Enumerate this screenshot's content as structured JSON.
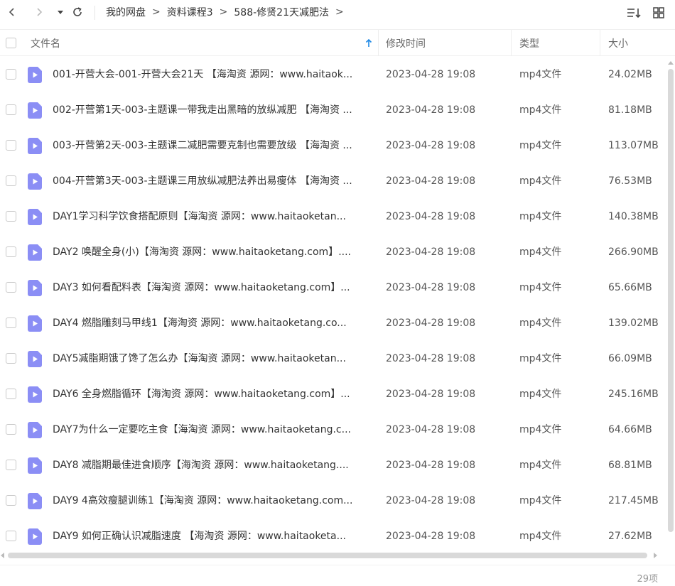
{
  "breadcrumb": [
    "我的网盘",
    "资料课程3",
    "588-修贤21天减肥法"
  ],
  "breadcrumb_separator": ">",
  "columns": {
    "name": "文件名",
    "modified": "修改时间",
    "type": "类型",
    "size": "大小"
  },
  "sort": {
    "column": "name",
    "direction": "ascending",
    "icon": "sort-arrow-up-icon"
  },
  "icons": {
    "file": "video-file-icon",
    "accent": "#8b8ef5"
  },
  "files": [
    {
      "name": "001-开营大会-001-开营大会21天 【海淘资 源网：www.haitaok...",
      "modified": "2023-04-28 19:08",
      "type": "mp4文件",
      "size": "24.02MB"
    },
    {
      "name": "002-开营第1天-003-主题课一带我走出黑暗的放纵减肥 【海淘资 ...",
      "modified": "2023-04-28 19:08",
      "type": "mp4文件",
      "size": "81.18MB"
    },
    {
      "name": "003-开营第2天-003-主题课二减肥需要克制也需要放级 【海淘资 ...",
      "modified": "2023-04-28 19:08",
      "type": "mp4文件",
      "size": "113.07MB"
    },
    {
      "name": "004-开营第3天-003-主题课三用放纵减肥法养出易瘦体 【海淘资 ...",
      "modified": "2023-04-28 19:08",
      "type": "mp4文件",
      "size": "76.53MB"
    },
    {
      "name": "DAY1学习科学饮食搭配原则【海淘资 源网：www.haitaoketan...",
      "modified": "2023-04-28 19:08",
      "type": "mp4文件",
      "size": "140.38MB"
    },
    {
      "name": "DAY2 唤醒全身(小)【海淘资 源网：www.haitaoketang.com】....",
      "modified": "2023-04-28 19:08",
      "type": "mp4文件",
      "size": "266.90MB"
    },
    {
      "name": "DAY3 如何看配料表【海淘资 源网：www.haitaoketang.com】...",
      "modified": "2023-04-28 19:08",
      "type": "mp4文件",
      "size": "65.66MB"
    },
    {
      "name": "DAY4 燃脂雕刻马甲线1【海淘资 源网：www.haitaoketang.co...",
      "modified": "2023-04-28 19:08",
      "type": "mp4文件",
      "size": "139.02MB"
    },
    {
      "name": "DAY5减脂期饿了馋了怎么办【海淘资 源网：www.haitaoketan...",
      "modified": "2023-04-28 19:08",
      "type": "mp4文件",
      "size": "66.09MB"
    },
    {
      "name": "DAY6 全身燃脂循环【海淘资 源网：www.haitaoketang.com】...",
      "modified": "2023-04-28 19:08",
      "type": "mp4文件",
      "size": "245.16MB"
    },
    {
      "name": "DAY7为什么一定要吃主食【海淘资 源网：www.haitaoketang.c...",
      "modified": "2023-04-28 19:08",
      "type": "mp4文件",
      "size": "64.66MB"
    },
    {
      "name": "DAY8 减脂期最佳进食顺序【海淘资 源网：www.haitaoketang....",
      "modified": "2023-04-28 19:08",
      "type": "mp4文件",
      "size": "68.81MB"
    },
    {
      "name": "DAY9 4高效瘦腿训练1【海淘资 源网：www.haitaoketang.com...",
      "modified": "2023-04-28 19:08",
      "type": "mp4文件",
      "size": "217.45MB"
    },
    {
      "name": "DAY9 如何正确认识减脂速度 【海淘资 源网：www.haitaoketa...",
      "modified": "2023-04-28 19:08",
      "type": "mp4文件",
      "size": "27.62MB"
    }
  ],
  "footer": {
    "count": "29项"
  }
}
